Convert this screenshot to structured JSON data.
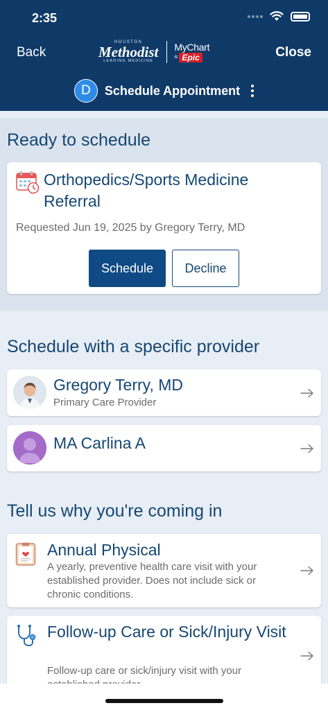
{
  "status": {
    "time": "2:35"
  },
  "nav": {
    "back_label": "Back",
    "close_label": "Close"
  },
  "logo": {
    "houston": "HOUSTON",
    "name": "Methodist",
    "tagline": "LEADING MEDICINE",
    "mychart": "MyChart",
    "is": "is",
    "epic": "Epic"
  },
  "header": {
    "avatar_letter": "D",
    "title": "Schedule Appointment"
  },
  "ready": {
    "heading": "Ready to schedule",
    "referral": {
      "title": "Orthopedics/Sports Medicine Referral",
      "meta": "Requested Jun 19, 2025 by Gregory Terry, MD",
      "schedule_label": "Schedule",
      "decline_label": "Decline"
    }
  },
  "providers": {
    "heading": "Schedule with a specific provider",
    "items": [
      {
        "name": "Gregory Terry, MD",
        "role": "Primary Care Provider"
      },
      {
        "name": "MA Carlina A",
        "role": ""
      }
    ]
  },
  "reasons": {
    "heading": "Tell us why you're coming in",
    "items": [
      {
        "title": "Annual Physical",
        "description": "A yearly, preventive health care visit with your established provider. Does not include sick or chronic conditions."
      },
      {
        "title": "Follow-up Care or Sick/Injury Visit",
        "description": "Follow-up care or sick/injury visit with your established provider."
      }
    ]
  },
  "colors": {
    "header_bg": "#0f3a68",
    "accent": "#154774",
    "primary_button": "#0f4a84",
    "epic_red": "#d5202a"
  },
  "icons": [
    "wifi-icon",
    "battery-icon",
    "calendar-clock-icon",
    "arrow-right-icon",
    "clipboard-heart-icon",
    "stethoscope-icon",
    "kebab-menu-icon"
  ]
}
